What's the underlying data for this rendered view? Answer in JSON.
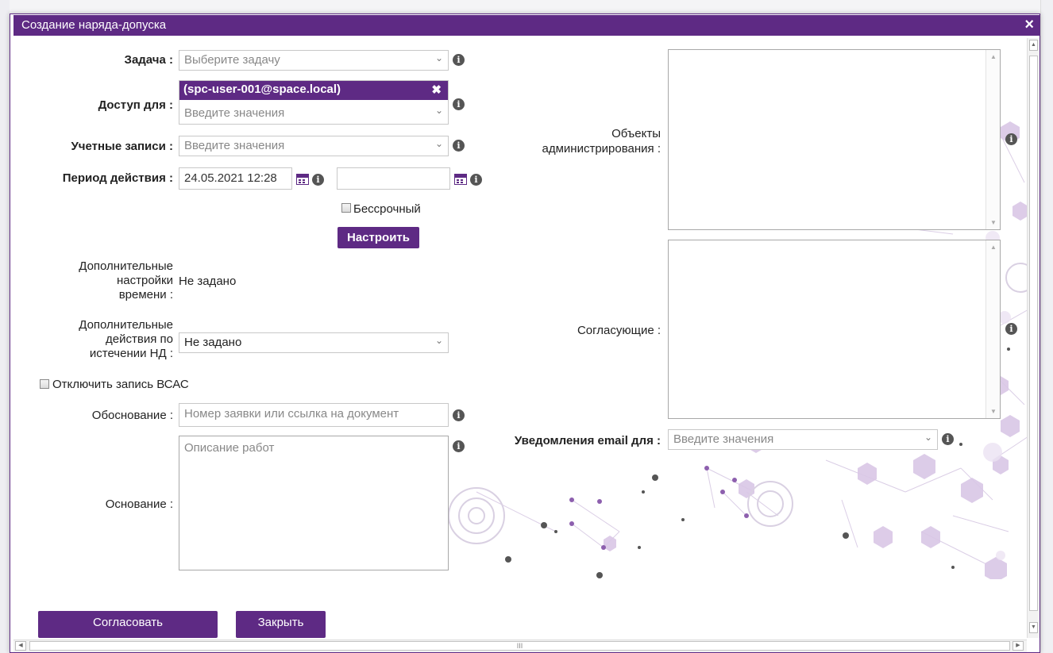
{
  "dialog": {
    "title": "Создание наряда-допуска",
    "close_icon": "×"
  },
  "form": {
    "task": {
      "label": "Задача :",
      "placeholder": "Выберите задачу"
    },
    "access_for": {
      "label": "Доступ для :",
      "chip": "(spc-user-001@space.local)",
      "placeholder": "Введите значения"
    },
    "accounts": {
      "label": "Учетные записи :",
      "placeholder": "Введите значения"
    },
    "period": {
      "label": "Период действия :",
      "start_value": "24.05.2021 12:28",
      "end_value": ""
    },
    "indefinite": {
      "label": "Бессрочный"
    },
    "configure_button": "Настроить",
    "extra_time": {
      "label_lines": [
        "Дополнительные",
        "настройки",
        "времени :"
      ],
      "value": "Не задано"
    },
    "extra_actions": {
      "label_lines": [
        "Дополнительные",
        "действия по",
        "истечении НД :"
      ],
      "value": "Не задано"
    },
    "disable_recording": {
      "label": "Отключить запись ВСАС"
    },
    "justification": {
      "label": "Обоснование :",
      "placeholder": "Номер заявки или ссылка на документ"
    },
    "basis": {
      "label": "Основание :",
      "placeholder": "Описание работ"
    },
    "admin_objects": {
      "label_lines": [
        "Объекты",
        "администрирования :"
      ]
    },
    "approvers": {
      "label": "Согласующие :"
    },
    "email_notify": {
      "label": "Уведомления email для :",
      "placeholder": "Введите значения"
    }
  },
  "buttons": {
    "approve": "Согласовать",
    "close": "Закрыть"
  },
  "scrollbar": {
    "grip": "III"
  },
  "colors": {
    "accent": "#5e2a84",
    "border": "#c8c8c8",
    "info_icon": "#555555"
  }
}
